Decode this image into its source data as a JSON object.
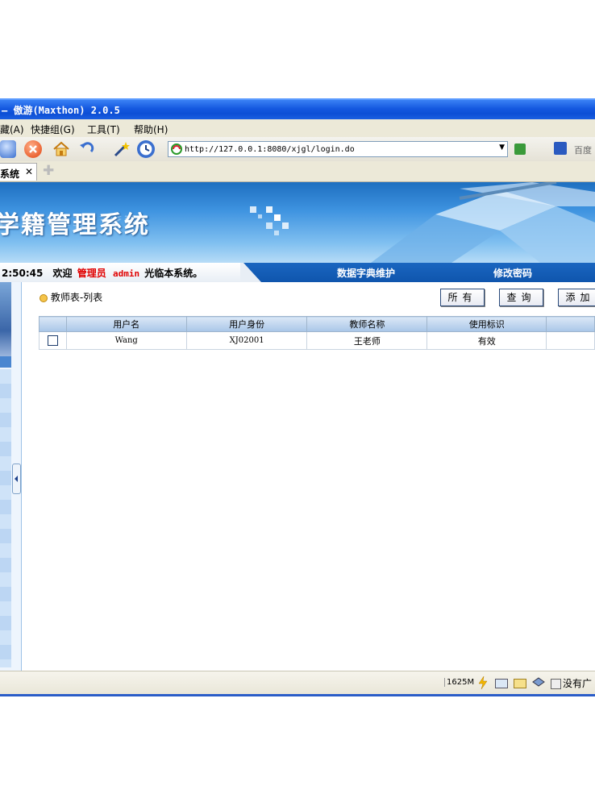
{
  "window": {
    "title": "— 傲游(Maxthon) 2.0.5"
  },
  "menu": [
    "藏(A)",
    "快捷组(G)",
    "工具(T)",
    "帮助(H)"
  ],
  "address": {
    "url": "http://127.0.0.1:8080/xjgl/login.do",
    "search_placeholder": "百度"
  },
  "tab": {
    "label": "系统"
  },
  "banner": {
    "system_name": "学籍管理系统"
  },
  "infobar": {
    "time": "2:50:45",
    "welcome": "欢迎",
    "role": "管理员",
    "user": "admin",
    "suffix": "光临本系统。",
    "nav": [
      "数据字典维护",
      "修改密码"
    ]
  },
  "page": {
    "breadcrumb": "教师表-列表",
    "buttons": {
      "all": "所有",
      "query": "查询",
      "add": "添加"
    }
  },
  "table": {
    "headers": [
      "用户名",
      "用户身份",
      "教师名称",
      "使用标识"
    ],
    "rows": [
      {
        "username": "Wang",
        "identity": "XJ02001",
        "teacher": "王老师",
        "flag": "有效"
      }
    ]
  },
  "status": {
    "memory": "1625M",
    "noad": "没有广"
  },
  "colors": {
    "title_blue": "#0d4fd6",
    "banner_blue": "#3e93e0",
    "info_blue": "#0f55ad",
    "red_text": "#e00000"
  }
}
